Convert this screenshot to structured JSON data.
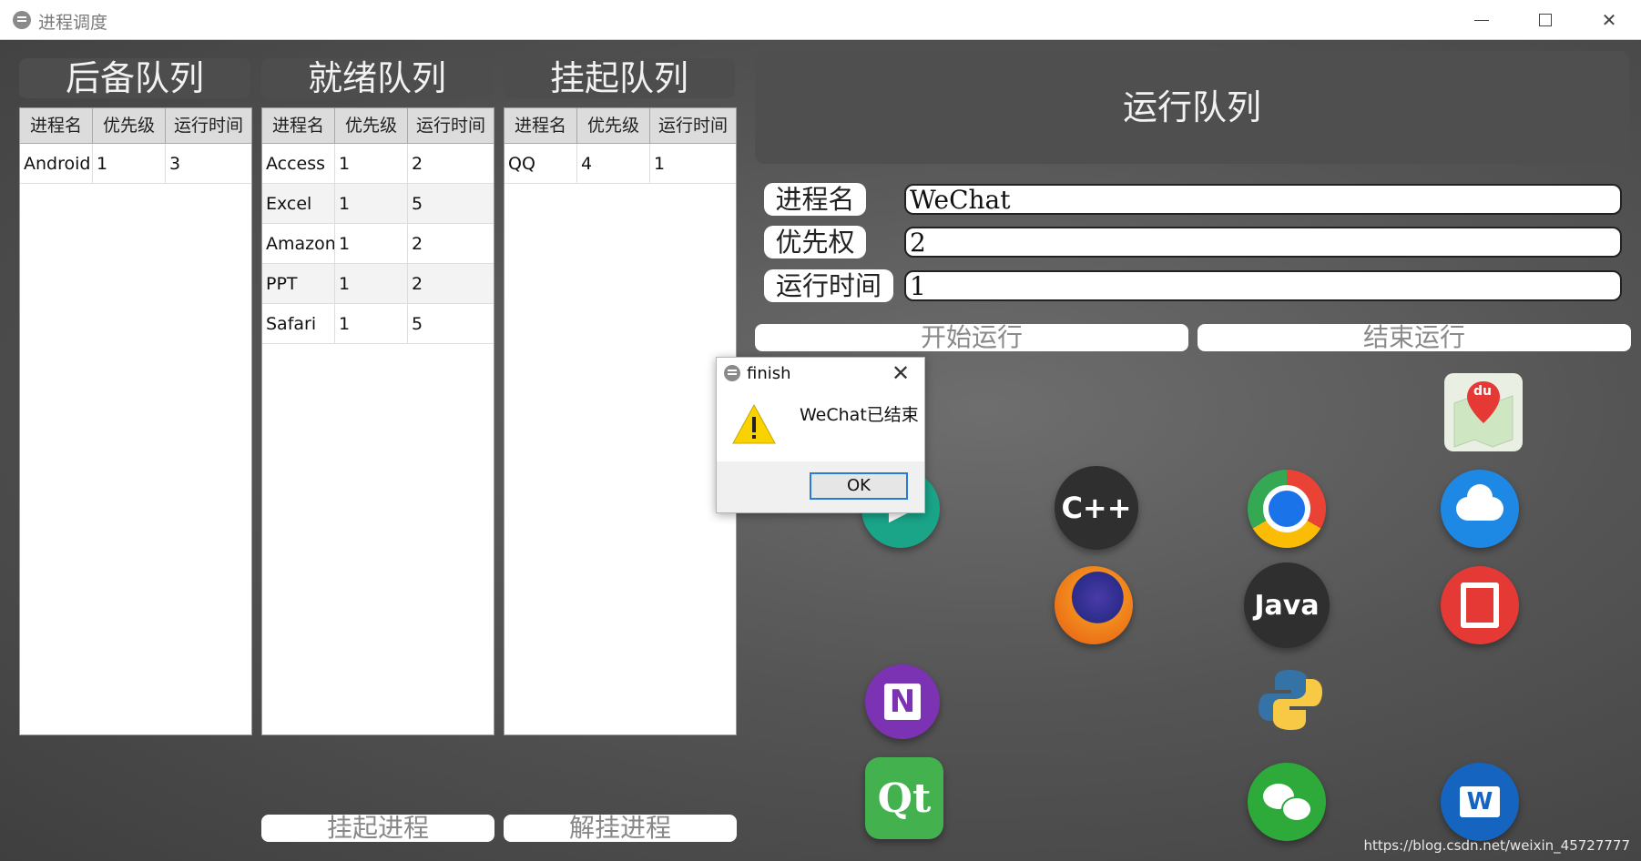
{
  "window": {
    "title": "进程调度"
  },
  "backup": {
    "title": "后备队列",
    "columns": [
      "进程名",
      "优先级",
      "运行时间"
    ],
    "rows": [
      [
        "Android",
        "1",
        "3"
      ]
    ]
  },
  "ready": {
    "title": "就绪队列",
    "columns": [
      "进程名",
      "优先级",
      "运行时间"
    ],
    "rows": [
      [
        "Access",
        "1",
        "2"
      ],
      [
        "Excel",
        "1",
        "5"
      ],
      [
        "Amazon",
        "1",
        "2"
      ],
      [
        "PPT",
        "1",
        "2"
      ],
      [
        "Safari",
        "1",
        "5"
      ]
    ],
    "button": "挂起进程"
  },
  "suspended": {
    "title": "挂起队列",
    "columns": [
      "进程名",
      "优先级",
      "运行时间"
    ],
    "rows": [
      [
        "QQ",
        "4",
        "1"
      ]
    ],
    "button": "解挂进程"
  },
  "running": {
    "title": "运行队列",
    "name_label": "进程名",
    "name_value": "WeChat",
    "priority_label": "优先权",
    "priority_value": "2",
    "time_label": "运行时间",
    "time_value": "1",
    "start_button": "开始运行",
    "end_button": "结束运行"
  },
  "apps": {
    "cpp": "C++",
    "java": "Java",
    "baidu": "du",
    "onenote": "N",
    "qt": "Qt",
    "word": "W"
  },
  "dialog": {
    "title": "finish",
    "message": "WeChat已结束",
    "ok": "OK"
  },
  "watermark": "https://blog.csdn.net/weixin_45727777",
  "colors": {
    "background": "#555555",
    "panel_header": "#4d4d4d",
    "dialog_focus": "#2a7bd6"
  }
}
